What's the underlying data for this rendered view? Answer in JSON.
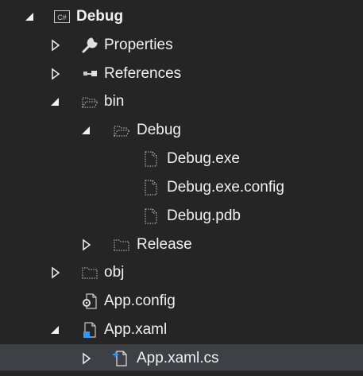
{
  "solution_explorer": {
    "nodes": [
      {
        "label": "Debug",
        "expander": "expanded",
        "icon": "csharp-project-icon",
        "bold": true
      },
      {
        "label": "Properties",
        "expander": "collapsed",
        "icon": "wrench-icon"
      },
      {
        "label": "References",
        "expander": "collapsed",
        "icon": "references-icon"
      },
      {
        "label": "bin",
        "expander": "expanded",
        "icon": "folder-open-icon"
      },
      {
        "label": "Debug",
        "expander": "expanded",
        "icon": "folder-open-icon"
      },
      {
        "label": "Debug.exe",
        "expander": "none",
        "icon": "file-icon"
      },
      {
        "label": "Debug.exe.config",
        "expander": "none",
        "icon": "file-icon"
      },
      {
        "label": "Debug.pdb",
        "expander": "none",
        "icon": "file-icon"
      },
      {
        "label": "Release",
        "expander": "collapsed",
        "icon": "folder-closed-icon"
      },
      {
        "label": "obj",
        "expander": "collapsed",
        "icon": "folder-closed-icon"
      },
      {
        "label": "App.config",
        "expander": "none",
        "icon": "config-file-icon"
      },
      {
        "label": "App.xaml",
        "expander": "expanded",
        "icon": "xaml-file-icon"
      },
      {
        "label": "App.xaml.cs",
        "expander": "collapsed",
        "icon": "csharp-file-icon",
        "selected": true
      }
    ],
    "colors": {
      "background": "#252526",
      "text": "#f1f1f1",
      "selected_row": "#3f3f46",
      "icon_gray": "#c8c8c8",
      "icon_blue": "#3399ff"
    }
  }
}
